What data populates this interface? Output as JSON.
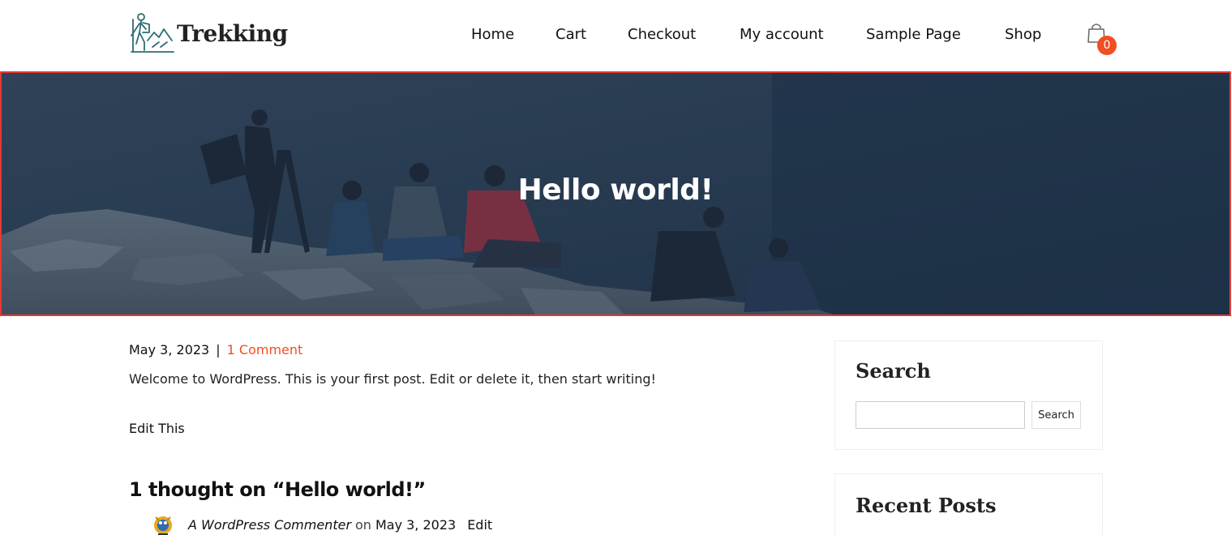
{
  "site": {
    "name": "Trekking",
    "accent_color": "#f04e23",
    "logo_icon": "hiker-mountain-icon"
  },
  "nav": {
    "items": [
      {
        "label": "Home"
      },
      {
        "label": "Cart"
      },
      {
        "label": "Checkout"
      },
      {
        "label": "My account"
      },
      {
        "label": "Sample Page"
      },
      {
        "label": "Shop"
      }
    ],
    "cart_icon": "shopping-bag-icon",
    "cart_count": "0"
  },
  "hero": {
    "title": "Hello world!",
    "overlay_color": "#1e3149",
    "border_color": "#e53935"
  },
  "post": {
    "date": "May 3, 2023",
    "separator": "|",
    "comments_link": "1 Comment",
    "excerpt": "Welcome to WordPress. This is your first post. Edit or delete it, then start writing!",
    "edit_link": "Edit This"
  },
  "comments": {
    "title": "1 thought on “Hello world!”",
    "items": [
      {
        "author": "A WordPress Commenter",
        "on": "on",
        "date": "May 3, 2023",
        "edit": "Edit",
        "avatar_icon": "wapuu-avatar-icon"
      }
    ]
  },
  "sidebar": {
    "search": {
      "title": "Search",
      "input_value": "",
      "button_label": "Search"
    },
    "recent_posts": {
      "title": "Recent Posts"
    }
  }
}
